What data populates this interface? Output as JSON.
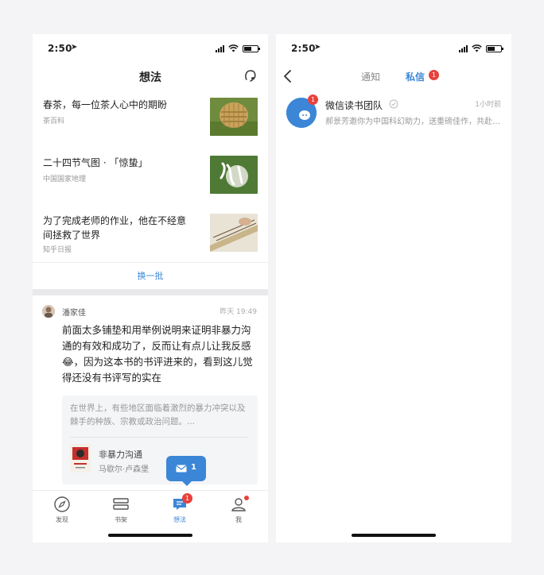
{
  "status": {
    "time": "2:50"
  },
  "left": {
    "title": "想法",
    "articles": [
      {
        "title": "春茶，每一位茶人心中的期盼",
        "source": "茶百科"
      },
      {
        "title": "二十四节气图 · 「惊蛰」",
        "source": "中国国家地理"
      },
      {
        "title": "为了完成老师的作业，他在不经意间拯救了世界",
        "source": "知乎日报"
      }
    ],
    "refresh_label": "换一批",
    "post": {
      "author": "潘家佳",
      "time": "昨天 19:49",
      "text": "前面太多铺垫和用举例说明来证明非暴力沟通的有效和成功了，反而让有点儿让我反感😂，因为这本书的书评进来的，看到这儿觉得还没有书评写的实在",
      "quote": "在世界上，有些地区面临着激烈的暴力冲突以及棘手的种族、宗教或政治问题。...",
      "book_title": "非暴力沟通",
      "book_author": "马歇尔·卢森堡"
    },
    "message_bubble_count": "1",
    "tabs": [
      {
        "label": "发现"
      },
      {
        "label": "书架"
      },
      {
        "label": "想法",
        "badge": "1"
      },
      {
        "label": "我"
      }
    ]
  },
  "right": {
    "tab_notice": "通知",
    "tab_private": "私信",
    "private_badge": "1",
    "conversation": {
      "name": "微信读书团队",
      "time": "1小时前",
      "preview": "郝景芳邀你为中国科幻助力，送重磅佳作，共赴科幻盛宴",
      "badge": "1"
    }
  },
  "colors": {
    "accent": "#3b86d6",
    "badge": "#e9413c"
  }
}
